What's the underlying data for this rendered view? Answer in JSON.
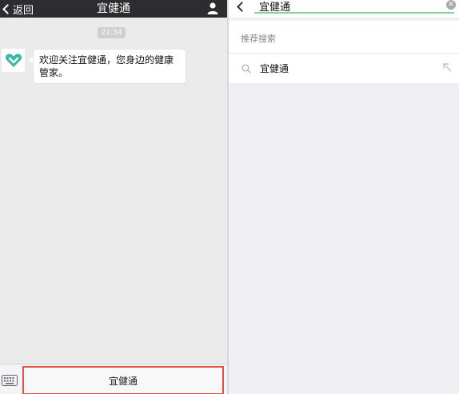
{
  "left": {
    "header": {
      "back_label": "返回",
      "title": "宜健通",
      "profile_icon": "person-icon"
    },
    "timestamp": "21:34",
    "message": {
      "avatar_icon": "heart-logo-icon",
      "text": "欢迎关注宜健通，您身边的健康管家。"
    },
    "bottom_bar": {
      "keyboard_icon": "keyboard-icon",
      "menu_button_label": "宜健通",
      "highlight_color": "#e05046"
    }
  },
  "right": {
    "search": {
      "back_icon": "chevron-left-icon",
      "query": "宜健通",
      "clear_icon": "clear-icon",
      "underline_color": "#8fd18f"
    },
    "suggestions": {
      "header": "推荐搜索",
      "items": [
        {
          "label": "宜健通",
          "icon": "search-icon",
          "action_icon": "fill-arrow-icon"
        }
      ]
    }
  },
  "colors": {
    "header_bg": "#2d2d2f",
    "chat_bg": "#ebebeb",
    "brand_teal": "#3bb8a8"
  }
}
